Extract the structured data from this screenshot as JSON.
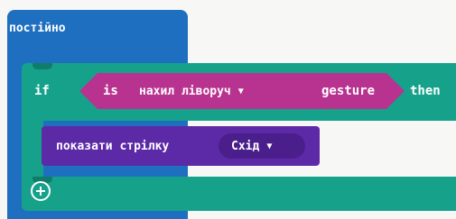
{
  "forever_block": {
    "label": "постійно",
    "color": "#1f6fc0"
  },
  "if_block": {
    "if_label": "if",
    "then_label": "then",
    "color": "#16a28a"
  },
  "gesture_block": {
    "is_label": "is",
    "gesture_value": "нахил ліворуч",
    "dropdown_icon": "triangle-down-icon",
    "gesture_label": "gesture",
    "color": "#b8338f"
  },
  "show_arrow_block": {
    "label": "показати стрілку",
    "direction_value": "Схід",
    "dropdown_icon": "triangle-down-icon",
    "color": "#5c2aa6"
  },
  "add_button": {
    "icon": "plus-circle-icon"
  }
}
